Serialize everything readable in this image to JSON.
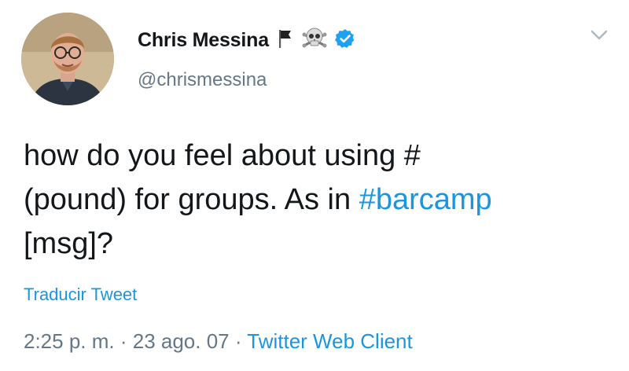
{
  "tweet": {
    "author": {
      "name": "Chris Messina",
      "handle": "@chrismessina",
      "badges": [
        "black-flag-icon",
        "skull-crossbones-icon",
        "verified-badge-icon"
      ]
    },
    "text": {
      "line1": "how do you feel about using #",
      "line2_prefix": "(pound) for groups. As in ",
      "hashtag": "#barcamp",
      "line3": "[msg]?"
    },
    "translate_label": "Traducir Tweet",
    "time": "2:25 p. m.",
    "separator1": " · ",
    "date": "23 ago. 07",
    "separator2": " · ",
    "source": "Twitter Web Client"
  },
  "colors": {
    "accent": "#1b95e0",
    "secondary_text": "#657786",
    "primary_text": "#14171a",
    "verified": "#1da1f2"
  }
}
